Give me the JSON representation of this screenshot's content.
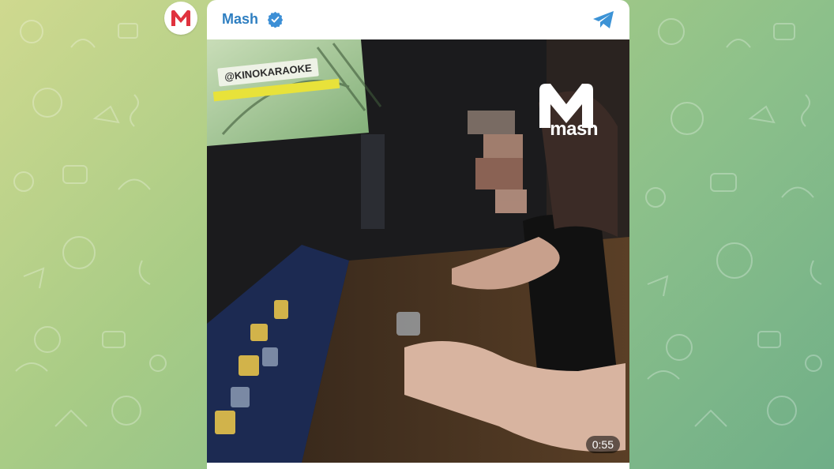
{
  "channel": {
    "name": "Mash",
    "avatar_icon": "mash-m-logo-icon",
    "verified_icon": "verified-badge-icon",
    "share_icon": "telegram-share-icon"
  },
  "video": {
    "overlay_text": "@KINOKARAOKE",
    "watermark_text": "mash",
    "duration": "0:55"
  },
  "colors": {
    "brand_blue": "#2f7fc1",
    "mash_red": "#e0323e",
    "background_start": "#cfd98f",
    "background_end": "#6fae88"
  }
}
